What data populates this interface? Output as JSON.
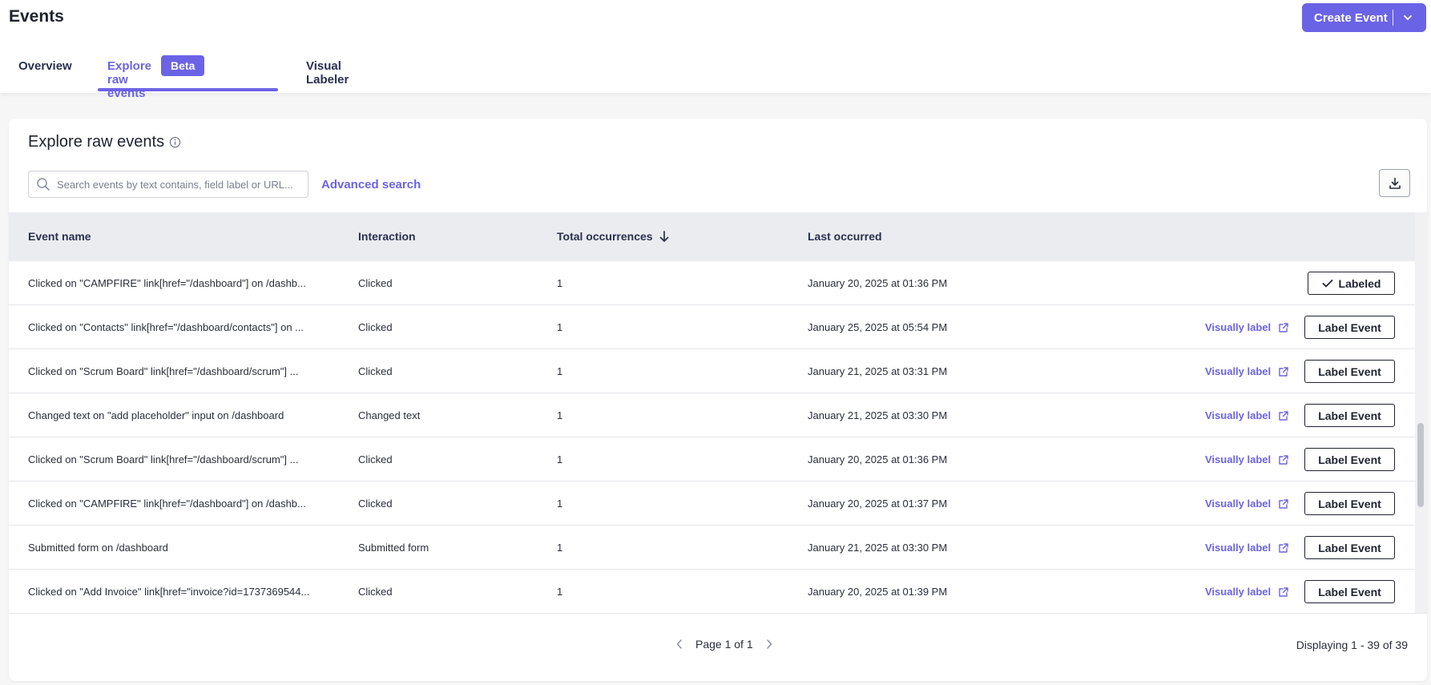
{
  "header": {
    "title": "Events",
    "create_button": "Create Event"
  },
  "tabs": [
    {
      "label": "Overview"
    },
    {
      "label": "Explore raw events",
      "badge": "Beta"
    },
    {
      "label": "Visual Labeler"
    }
  ],
  "card": {
    "title": "Explore raw events",
    "search": {
      "placeholder": "Search events by text contains, field label or URL...",
      "value": ""
    },
    "advanced_search": "Advanced search"
  },
  "table": {
    "columns": {
      "event_name": "Event name",
      "interaction": "Interaction",
      "total": "Total occurrences",
      "last": "Last occurred"
    },
    "visually_label": "Visually label",
    "label_event": "Label Event",
    "labeled": "Labeled",
    "rows": [
      {
        "name": "Clicked on \"CAMPFIRE\" link[href=\"/dashboard\"] on /dashb...",
        "interaction": "Clicked",
        "total": "1",
        "last": "January 20, 2025 at 01:36 PM",
        "labeled": true
      },
      {
        "name": "Clicked on \"Contacts\" link[href=\"/dashboard/contacts\"] on ...",
        "interaction": "Clicked",
        "total": "1",
        "last": "January 25, 2025 at 05:54 PM",
        "labeled": false
      },
      {
        "name": "Clicked on \"Scrum Board\" link[href=\"/dashboard/scrum\"] ...",
        "interaction": "Clicked",
        "total": "1",
        "last": "January 21, 2025 at 03:31 PM",
        "labeled": false
      },
      {
        "name": "Changed text on \"add placeholder\" input on /dashboard",
        "interaction": "Changed text",
        "total": "1",
        "last": "January 21, 2025 at 03:30 PM",
        "labeled": false
      },
      {
        "name": "Clicked on \"Scrum Board\" link[href=\"/dashboard/scrum\"] ...",
        "interaction": "Clicked",
        "total": "1",
        "last": "January 20, 2025 at 01:36 PM",
        "labeled": false
      },
      {
        "name": "Clicked on \"CAMPFIRE\" link[href=\"/dashboard\"] on /dashb...",
        "interaction": "Clicked",
        "total": "1",
        "last": "January 20, 2025 at 01:37 PM",
        "labeled": false
      },
      {
        "name": "Submitted form on /dashboard",
        "interaction": "Submitted form",
        "total": "1",
        "last": "January 21, 2025 at 03:30 PM",
        "labeled": false
      },
      {
        "name": "Clicked on \"Add Invoice\" link[href=\"invoice?id=1737369544...",
        "interaction": "Clicked",
        "total": "1",
        "last": "January 20, 2025 at 01:39 PM",
        "labeled": false
      }
    ]
  },
  "footer": {
    "page": "Page 1 of 1",
    "displaying": "Displaying 1 - 39 of 39"
  },
  "colors": {
    "accent": "#6b63e6",
    "header_bg": "#ebecef"
  }
}
